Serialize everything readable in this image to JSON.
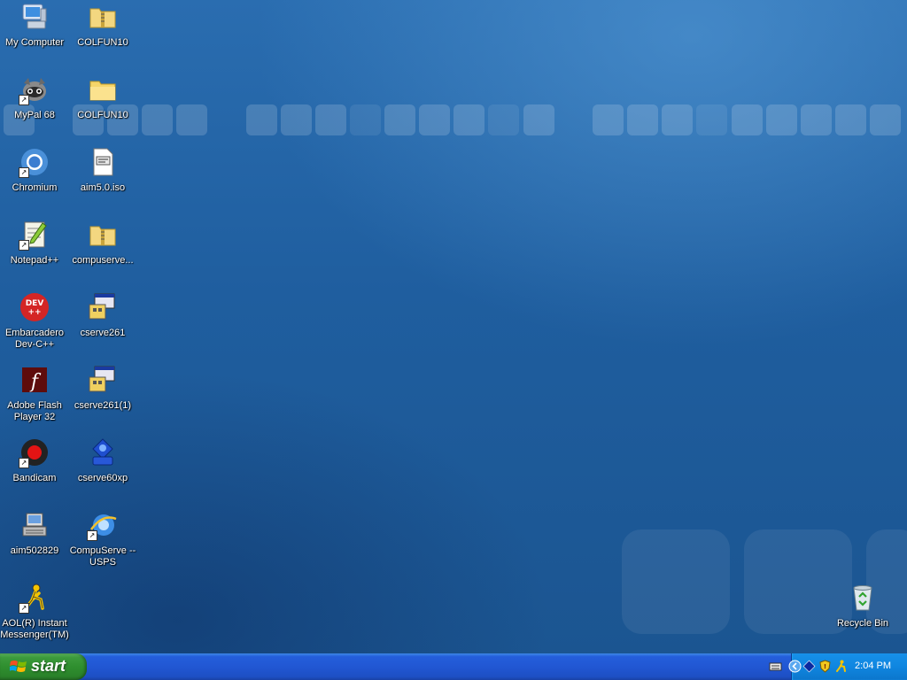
{
  "desktop": {
    "icons_col1": [
      {
        "label": "My Computer",
        "icon": "my-computer-icon"
      },
      {
        "label": "MyPal 68",
        "icon": "mypal-icon"
      },
      {
        "label": "Chromium",
        "icon": "chromium-icon"
      },
      {
        "label": "Notepad++",
        "icon": "notepadpp-icon"
      },
      {
        "label": "Embarcadero Dev-C++",
        "icon": "devcpp-icon"
      },
      {
        "label": "Adobe Flash Player 32",
        "icon": "flash-icon"
      },
      {
        "label": "Bandicam",
        "icon": "bandicam-icon"
      },
      {
        "label": "aim502829",
        "icon": "installer-icon"
      },
      {
        "label": "AOL(R) Instant Messenger(TM)",
        "icon": "aim-icon"
      }
    ],
    "icons_col2": [
      {
        "label": "COLFUN10",
        "icon": "zip-folder-icon"
      },
      {
        "label": "COLFUN10",
        "icon": "folder-icon"
      },
      {
        "label": "aim5.0.iso",
        "icon": "iso-file-icon"
      },
      {
        "label": "compuserve...",
        "icon": "zip-folder-icon"
      },
      {
        "label": "cserve261",
        "icon": "setup-icon"
      },
      {
        "label": "cserve261(1)",
        "icon": "setup-icon"
      },
      {
        "label": "cserve60xp",
        "icon": "compuserve-icon"
      },
      {
        "label": "CompuServe -- USPS",
        "icon": "ie-icon"
      }
    ],
    "recycle_bin": {
      "label": "Recycle Bin",
      "icon": "recycle-bin-icon"
    }
  },
  "taskbar": {
    "start_label": "start",
    "clock": "2:04 PM"
  },
  "colors": {
    "desktop_blue": "#1f5e9f",
    "taskbar_blue": "#245edb",
    "start_green": "#3c9a3c",
    "tray_blue": "#0f86e0"
  }
}
